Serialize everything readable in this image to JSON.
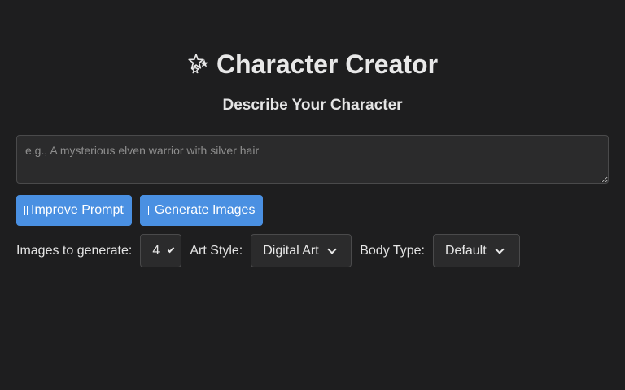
{
  "header": {
    "icon": "sparkles-icon",
    "title": "Character Creator",
    "subtitle": "Describe Your Character"
  },
  "prompt": {
    "value": "",
    "placeholder": "e.g., A mysterious elven warrior with silver hair"
  },
  "actions": {
    "improve_label": "Improve Prompt",
    "generate_label": "Generate Images"
  },
  "options": {
    "count_label": "Images to generate:",
    "count_value": "4",
    "style_label": "Art Style:",
    "style_value": "Digital Art",
    "body_label": "Body Type:",
    "body_value": "Default"
  },
  "colors": {
    "background": "#1e1e1f",
    "accent": "#4a90e2",
    "field": "#2b2b2c"
  }
}
